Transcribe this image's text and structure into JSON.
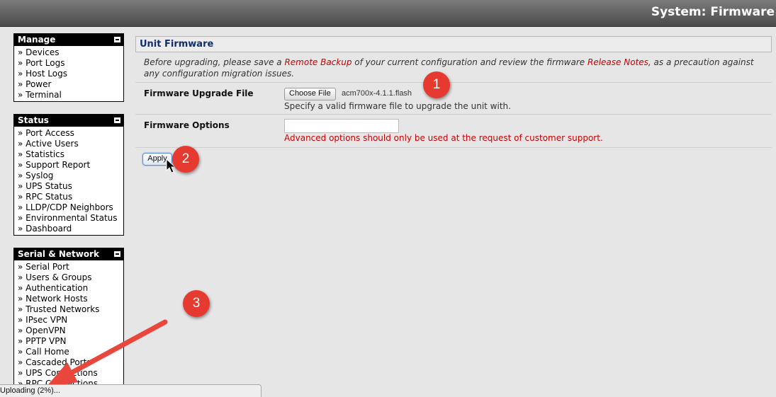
{
  "header": {
    "title": "System: Firmware"
  },
  "sidebar": {
    "manage": {
      "title": "Manage",
      "items": [
        "» Devices",
        "» Port Logs",
        "» Host Logs",
        "» Power",
        "» Terminal"
      ]
    },
    "status": {
      "title": "Status",
      "items": [
        "» Port Access",
        "» Active Users",
        "» Statistics",
        "» Support Report",
        "» Syslog",
        "» UPS Status",
        "» RPC Status",
        "» LLDP/CDP Neighbors",
        "» Environmental Status",
        "» Dashboard"
      ]
    },
    "serial": {
      "title": "Serial & Network",
      "items": [
        "» Serial Port",
        "» Users & Groups",
        "» Authentication",
        "» Network Hosts",
        "» Trusted Networks",
        "» IPsec VPN",
        "» OpenVPN",
        "» PPTP VPN",
        "» Call Home",
        "» Cascaded Ports",
        "» UPS Connections",
        "» RPC Connections"
      ]
    }
  },
  "main": {
    "section_title": "Unit Firmware",
    "intro": {
      "part1": "Before upgrading, please save a ",
      "link1": "Remote Backup",
      "part2": " of your current configuration and review the firmware ",
      "link2": "Release Notes",
      "part3": ", as a precaution against any configuration migration issues."
    },
    "upgrade": {
      "label": "Firmware Upgrade File",
      "button": "Choose File",
      "filename": "acm700x-4.1.1.flash",
      "hint": "Specify a valid firmware file to upgrade the unit with."
    },
    "options": {
      "label": "Firmware Options",
      "value": "",
      "warning": "Advanced options should only be used at the request of customer support."
    },
    "apply_label": "Apply"
  },
  "annotations": {
    "b1": "1",
    "b2": "2",
    "b3": "3",
    "arrow_color": "#e9473b"
  },
  "statusbar": {
    "text": "Uploading (2%)..."
  }
}
